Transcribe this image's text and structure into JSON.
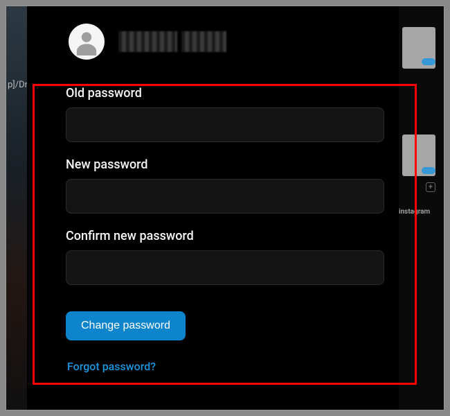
{
  "background": {
    "left_text": "p]/Dr",
    "right_label": "instagram",
    "right_sub": "",
    "plus": "+"
  },
  "user": {
    "name_redacted": true
  },
  "form": {
    "old_password": {
      "label": "Old password",
      "value": ""
    },
    "new_password": {
      "label": "New password",
      "value": ""
    },
    "confirm_password": {
      "label": "Confirm new password",
      "value": ""
    },
    "submit_label": "Change password"
  },
  "links": {
    "forgot": "Forgot password?"
  },
  "highlight": {
    "color": "#ff0000"
  }
}
